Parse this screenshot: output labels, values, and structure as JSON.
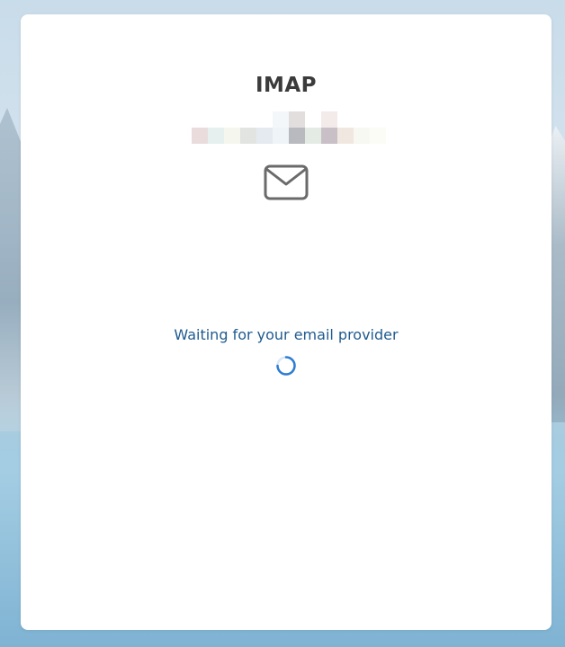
{
  "dialog": {
    "title": "IMAP",
    "status_text": "Waiting for your email provider",
    "icon": "mail-icon",
    "loading_indicator": "spinner"
  },
  "colors": {
    "title": "#3b3b3b",
    "status_text": "#1f5a8f",
    "spinner": "#2b7cd3",
    "card_background": "#ffffff"
  }
}
